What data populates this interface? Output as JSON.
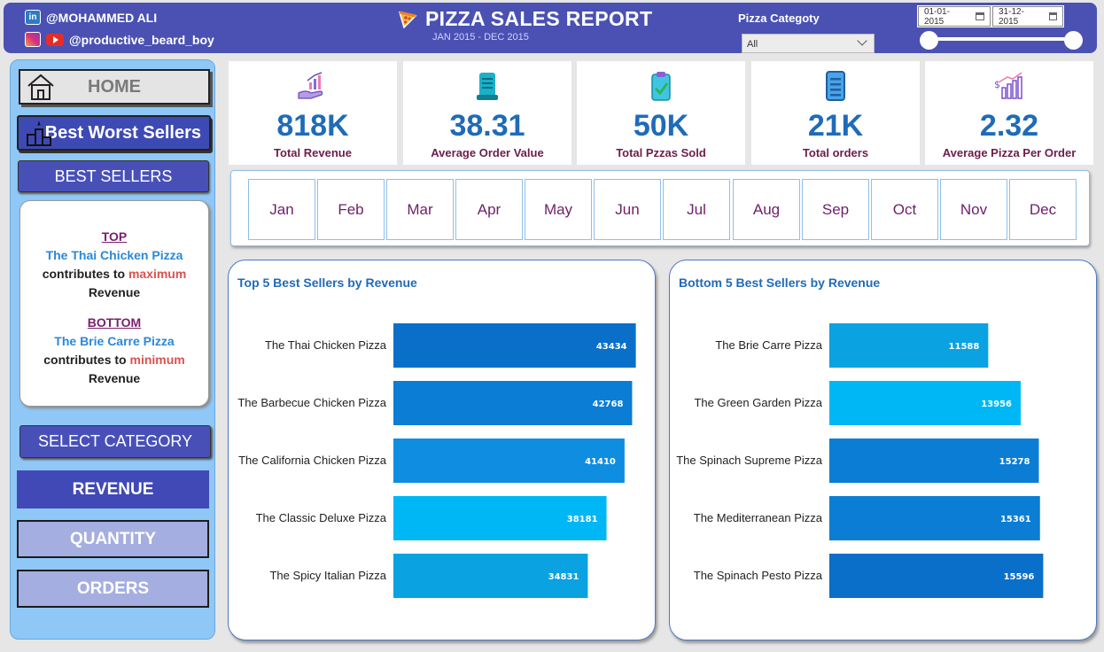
{
  "header": {
    "linkedin_handle": "@MOHAMMED ALI",
    "social_handle": "@productive_beard_boy",
    "title": "PIZZA SALES REPORT",
    "subtitle": "JAN 2015 - DEC 2015",
    "category_label": "Pizza Categoty",
    "category_value": "All",
    "date_start": "01-01-2015",
    "date_end": "31-12-2015"
  },
  "sidebar": {
    "home": "HOME",
    "best_worst": "Best Worst Sellers",
    "best_sellers": "BEST SELLERS",
    "info": {
      "top_head": "TOP",
      "top_pizza": "The Thai Chicken Pizza",
      "top_line_a": "contributes to",
      "top_line_b": "maximum",
      "top_line_c": "Revenue",
      "bottom_head": "BOTTOM",
      "bottom_pizza": "The Brie Carre Pizza",
      "bottom_line_a": "contributes to",
      "bottom_line_b": "minimum",
      "bottom_line_c": "Revenue"
    },
    "select_category": "SELECT CATEGORY",
    "revenue": "REVENUE",
    "quantity": "QUANTITY",
    "orders": "ORDERS"
  },
  "kpis": [
    {
      "value": "818K",
      "label": "Total Revenue",
      "icon": "revenue-icon"
    },
    {
      "value": "38.31",
      "label": "Average Order Value",
      "icon": "receipt-icon"
    },
    {
      "value": "50K",
      "label": "Total Pzzas Sold",
      "icon": "clipboard-check-icon"
    },
    {
      "value": "21K",
      "label": "Total orders",
      "icon": "document-icon"
    },
    {
      "value": "2.32",
      "label": "Average Pizza Per Order",
      "icon": "growth-chart-icon"
    }
  ],
  "months": [
    "Jan",
    "Feb",
    "Mar",
    "Apr",
    "May",
    "Jun",
    "Jul",
    "Aug",
    "Sep",
    "Oct",
    "Nov",
    "Dec"
  ],
  "colors": {
    "header": "#4a51b3",
    "accent_blue": "#1f6bb8",
    "bar_dark": "#0a6fc8",
    "bar_mid": "#0f8de0",
    "bar_light": "#00b7f5",
    "bar_teal": "#0aa2e0"
  },
  "chart_data": [
    {
      "type": "bar",
      "orientation": "horizontal",
      "title": "Top 5 Best Sellers by Revenue",
      "categories": [
        "The Thai Chicken Pizza",
        "The Barbecue Chicken Pizza",
        "The California Chicken Pizza",
        "The Classic Deluxe Pizza",
        "The Spicy Italian Pizza"
      ],
      "values": [
        43434,
        42768,
        41410,
        38181,
        34831
      ],
      "bar_colors": [
        "#0a6fc8",
        "#0b7dd4",
        "#0f8de0",
        "#00b7f5",
        "#0aa2e0"
      ],
      "xlim": [
        0,
        50000
      ],
      "grid": false,
      "legend": "none"
    },
    {
      "type": "bar",
      "orientation": "horizontal",
      "title": "Bottom 5 Best Sellers by Revenue",
      "categories": [
        "The Brie Carre Pizza",
        "The Green Garden Pizza",
        "The Spinach Supreme Pizza",
        "The Mediterranean Pizza",
        "The Spinach Pesto Pizza"
      ],
      "values": [
        11588,
        13956,
        15278,
        15361,
        15596
      ],
      "bar_colors": [
        "#0aa2e0",
        "#00b7f5",
        "#0b7dd4",
        "#0b7dd4",
        "#0a6fc8"
      ],
      "xlim": [
        0,
        19900
      ],
      "grid": false,
      "legend": "none"
    }
  ]
}
